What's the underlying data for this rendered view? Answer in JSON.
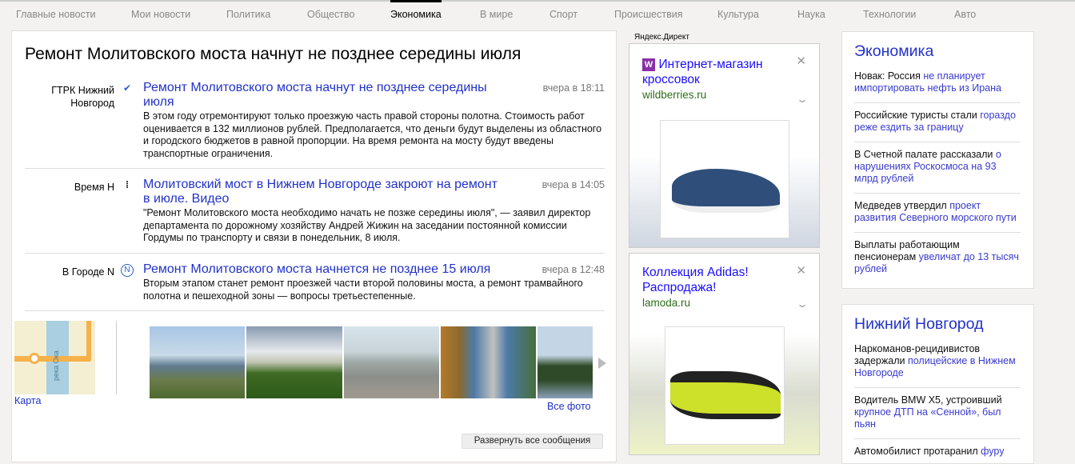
{
  "nav": {
    "items": [
      "Главные новости",
      "Мои новости",
      "Политика",
      "Общество",
      "Экономика",
      "В мире",
      "Спорт",
      "Происшествия",
      "Культура",
      "Наука",
      "Технологии",
      "Авто"
    ],
    "active": "Экономика"
  },
  "story": {
    "title": "Ремонт Молитовского моста начнут не позднее середины июля",
    "items": [
      {
        "source": "ГТРК Нижний Новгород",
        "title": "Ремонт Молитовского моста начнут не позднее середины июля",
        "time": "вчера в 18:11",
        "body": "В этом году отремонтируют только проезжую часть правой стороны полотна. Стоимость работ оценивается в 132 миллионов рублей. Предполагается, что деньги будут выделены из областного и городского бюджетов в равной пропорции. На время ремонта на мосту будут введены транспортные ограничения."
      },
      {
        "source": "Время Н",
        "title": "Молитовский мост в Нижнем Новгороде закроют на ремонт в июле. Видео",
        "time": "вчера в 14:05",
        "body": "\"Ремонт Молитовского моста необходимо начать не позже середины июля\", — заявил директор департамента по дорожному хозяйству Андрей Жижин на заседании постоянной комиссии Гордумы по транспорту и связи в понедельник, 8 июля."
      },
      {
        "source": "В Городе N",
        "title": "Ремонт Молитовского моста начнется не позднее 15 июля",
        "time": "вчера в 12:48",
        "body": "Вторым этапом станет ремонт проезжей части второй половины моста, а ремонт трамвайного полотна и пешеходной зоны — вопросы третьестепенные."
      }
    ],
    "map_label": "река Ока",
    "map_link": "Карта",
    "all_photos": "Все фото",
    "expand_button": "Развернуть все сообщения"
  },
  "ads": {
    "header": "Яндекс.Директ",
    "items": [
      {
        "title": "Интернет-магазин кроссовок",
        "url": "wildberries.ru",
        "badge": "W"
      },
      {
        "title": "Коллекция Adidas! Распродажа!",
        "url": "lamoda.ru"
      }
    ]
  },
  "sidebar": [
    {
      "heading": "Экономика",
      "items": [
        {
          "plain": "Новак: Россия ",
          "link": "не планирует импортировать нефть из Ирана"
        },
        {
          "plain": "Российские туристы стали ",
          "link": "гораздо реже ездить за границу"
        },
        {
          "plain": "В Счетной палате рассказали ",
          "link": "о нарушениях Роскосмоса на 93 млрд рублей"
        },
        {
          "plain": "Медведев утвердил ",
          "link": "проект развития Северного морского пути"
        },
        {
          "plain": "Выплаты работающим пенсионерам ",
          "link": "увеличат до 13 тысяч рублей"
        }
      ]
    },
    {
      "heading": "Нижний Новгород",
      "items": [
        {
          "plain": "Наркоманов-рецидивистов задержали ",
          "link": "полицейские в Нижнем Новгороде"
        },
        {
          "plain": "Водитель BMW X5, устроивший ",
          "link": "крупное ДТП на «Сенной», был пьян"
        },
        {
          "plain": "Автомобилист протаранил ",
          "link": "фуру"
        }
      ]
    }
  ],
  "colors": {
    "link": "#2232c8",
    "ad_link": "#1a0dff",
    "ad_url": "#2d6e18",
    "background": "#f3f2f0"
  }
}
